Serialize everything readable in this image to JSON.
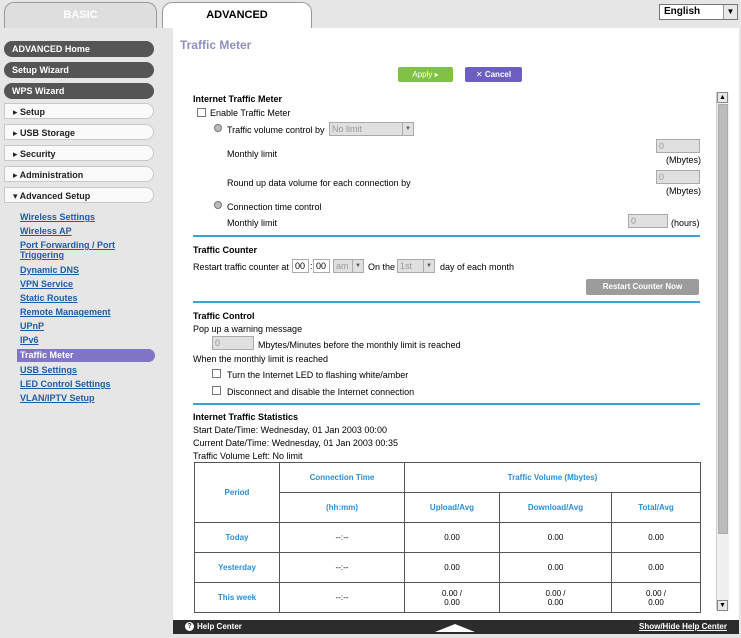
{
  "tabs": {
    "basic": "BASIC",
    "advanced": "ADVANCED"
  },
  "language": "English",
  "sidebar": {
    "dark": [
      "ADVANCED Home",
      "Setup Wizard",
      "WPS Wizard"
    ],
    "sections": [
      "▸ Setup",
      "▸ USB Storage",
      "▸ Security",
      "▸ Administration",
      "▾ Advanced Setup"
    ],
    "links": [
      "Wireless Settings",
      "Wireless AP",
      "Port Forwarding / Port Triggering",
      "Dynamic DNS",
      "VPN Service",
      "Static Routes",
      "Remote Management",
      "UPnP",
      "IPv6",
      "Traffic Meter",
      "USB Settings",
      "LED Control Settings",
      "VLAN/IPTV Setup"
    ]
  },
  "page": {
    "title": "Traffic Meter",
    "apply": "Apply ▸",
    "cancel": "✕ Cancel"
  },
  "itm": {
    "heading": "Internet Traffic Meter",
    "enable": "Enable Traffic Meter",
    "volume_ctrl": "Traffic volume control by",
    "volume_sel": "No limit",
    "monthly_limit": "Monthly limit",
    "monthly_val": "0",
    "mbytes": "(Mbytes)",
    "roundup": "Round up data volume for each connection by",
    "roundup_val": "0",
    "conn_time": "Connection time control",
    "monthly_limit2": "Monthly limit",
    "hours_val": "0",
    "hours": "(hours)"
  },
  "counter": {
    "heading": "Traffic Counter",
    "restart_at": "Restart traffic counter at",
    "hh": "00",
    "mm": "00",
    "ampm": "am",
    "on_the": "On the",
    "day": "1st",
    "day_of": "day of each month",
    "restart_btn": "Restart Counter Now"
  },
  "control": {
    "heading": "Traffic Control",
    "popup": "Pop up a warning message",
    "popup_val": "0",
    "popup_after": "Mbytes/Minutes before the monthly limit is reached",
    "when": "When the monthly limit is reached",
    "led": "Turn the Internet LED to flashing white/amber",
    "disconnect": "Disconnect and disable the Internet connection"
  },
  "stats": {
    "heading": "Internet Traffic Statistics",
    "start": "Start Date/Time: Wednesday, 01 Jan 2003 00:00",
    "current": "Current Date/Time: Wednesday, 01 Jan 2003 00:35",
    "left": "Traffic Volume Left: No limit",
    "col_period": "Period",
    "col_conn": "Connection Time",
    "col_conn_unit": "(hh:mm)",
    "col_volume": "Traffic Volume (Mbytes)",
    "col_up": "Upload/Avg",
    "col_down": "Download/Avg",
    "col_total": "Total/Avg",
    "rows": [
      {
        "period": "Today",
        "conn": "--:--",
        "up": "0.00",
        "down": "0.00",
        "total": "0.00"
      },
      {
        "period": "Yesterday",
        "conn": "--:--",
        "up": "0.00",
        "down": "0.00",
        "total": "0.00"
      },
      {
        "period": "This week",
        "conn": "--:--",
        "up": "0.00 /\n0.00",
        "down": "0.00 /\n0.00",
        "total": "0.00 /\n0.00"
      }
    ]
  },
  "footer": {
    "help": "Help Center",
    "show": "Show/Hide Help Center"
  }
}
